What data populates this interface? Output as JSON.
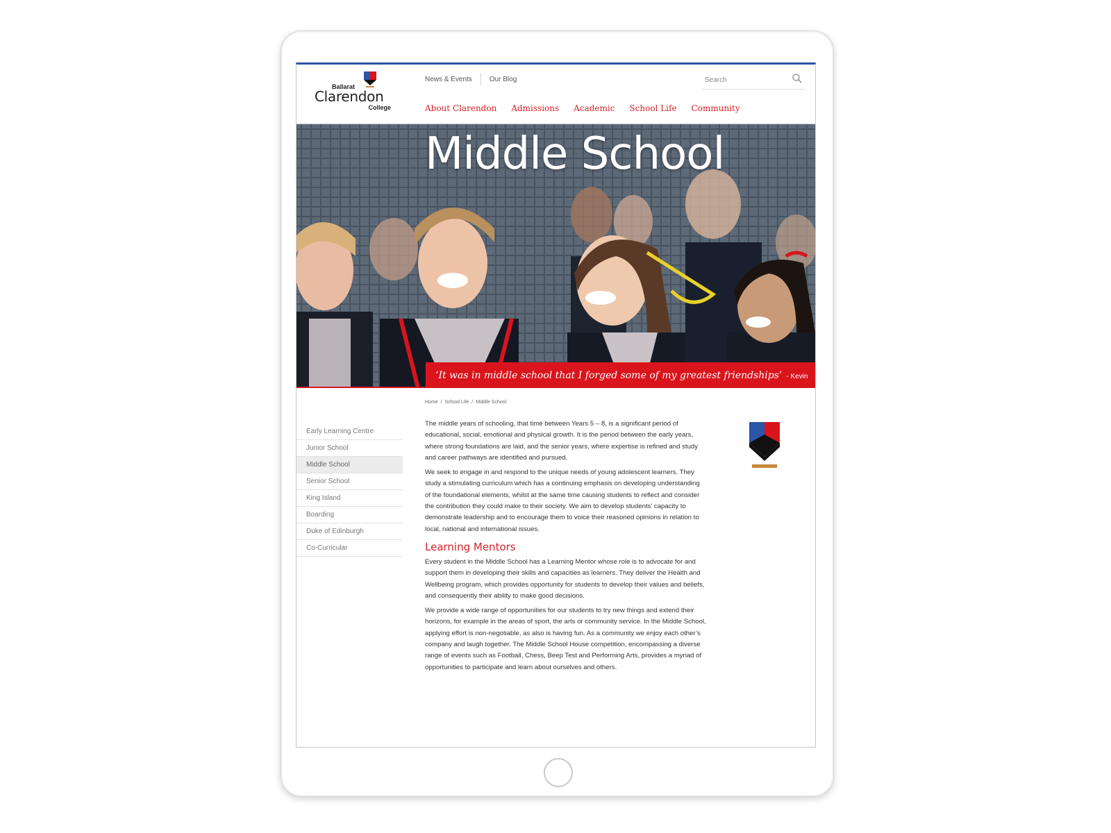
{
  "logo": {
    "top": "Ballarat",
    "name": "Clarendon",
    "bottom": "College"
  },
  "utility_nav": [
    "News & Events",
    "Our Blog"
  ],
  "search": {
    "placeholder": "Search"
  },
  "main_nav": [
    "About Clarendon",
    "Admissions",
    "Academic",
    "School Life",
    "Community"
  ],
  "hero": {
    "title": "Middle School",
    "quote": "‘It was in middle school that I forged some of my greatest friendships’",
    "quote_author": "- Kevin"
  },
  "breadcrumb": [
    "Home",
    "/",
    "School Life",
    "/",
    "Middle School"
  ],
  "sidebar": {
    "items": [
      "Early Learning Centre",
      "Junior School",
      "Middle School",
      "Senior School",
      "King Island",
      "Boarding",
      "Duke of Edinburgh",
      "Co-Curricular"
    ],
    "active": "Middle School"
  },
  "content": {
    "p1": "The middle years of schooling, that time between Years 5 – 8, is a significant period of educational, social, emotional and physical growth. It is the period between the early years, where strong foundations are laid, and the senior years, where expertise is refined and study and career pathways are identified and pursued.",
    "p2": "We seek to engage in and respond to the unique needs of young adolescent learners. They study a stimulating curriculum which has a continuing emphasis on developing understanding of the foundational elements, whilst at the same time causing students to reflect and consider the contribution they could make to their society. We aim to develop students’ capacity to demonstrate leadership and to encourage them to voice their reasoned opinions in relation to local, national and international issues.",
    "heading": "Learning Mentors",
    "p3": "Every student in the Middle School has a Learning Mentor whose role is to advocate for and support them in developing their skills and capacities as learners. They deliver the Health and Wellbeing program, which provides opportunity for students to develop their values and beliefs, and consequently their ability to make good decisions.",
    "p4": "We provide a wide range of opportunities for our students to try new things and extend their horizons, for example in the areas of sport, the arts or community service. In the Middle School, applying effort is non-negotiable, as also is having fun. As a community we enjoy each other’s company and laugh together. The Middle School House competition, encompassing a diverse range of events such as Football, Chess, Beep Test and Performing Arts, provides a myriad of opportunities to participate and learn about ourselves and others."
  },
  "colors": {
    "accent_red": "#d9141c",
    "brand_blue": "#2a55a8",
    "crest_gold": "#c8873a"
  }
}
